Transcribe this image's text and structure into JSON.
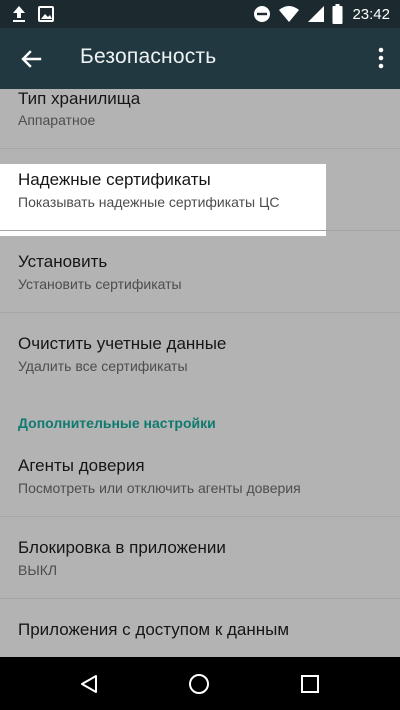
{
  "status_bar": {
    "time": "23:42",
    "icons": [
      "upload-icon",
      "image-icon",
      "do-not-disturb-icon",
      "wifi-icon",
      "signal-icon",
      "battery-icon"
    ]
  },
  "app_bar": {
    "title": "Безопасность",
    "back_icon": "arrow-back-icon",
    "menu_icon": "more-vert-icon"
  },
  "items": [
    {
      "title": "Тип хранилища",
      "summary": "Аппаратное"
    },
    {
      "title": "Надежные сертификаты",
      "summary": "Показывать надежные сертификаты ЦС"
    },
    {
      "title": "Установить",
      "summary": "Установить сертификаты"
    },
    {
      "title": "Очистить учетные данные",
      "summary": "Удалить все сертификаты"
    }
  ],
  "section_header": "Дополнительные настройки",
  "advanced_items": [
    {
      "title": "Агенты доверия",
      "summary": "Посмотреть или отключить агенты доверия"
    },
    {
      "title": "Блокировка в приложении",
      "summary": "ВЫКЛ"
    },
    {
      "title": "Приложения с доступом к данным"
    }
  ],
  "nav_bar": {
    "icons": [
      "back-triangle-icon",
      "home-circle-icon",
      "recents-square-icon"
    ]
  },
  "colors": {
    "status_bar": "#1c2a30",
    "app_bar": "#223840",
    "background": "#b3b3b3",
    "highlight": "#ffffff",
    "section_accent": "#0f7a70"
  }
}
